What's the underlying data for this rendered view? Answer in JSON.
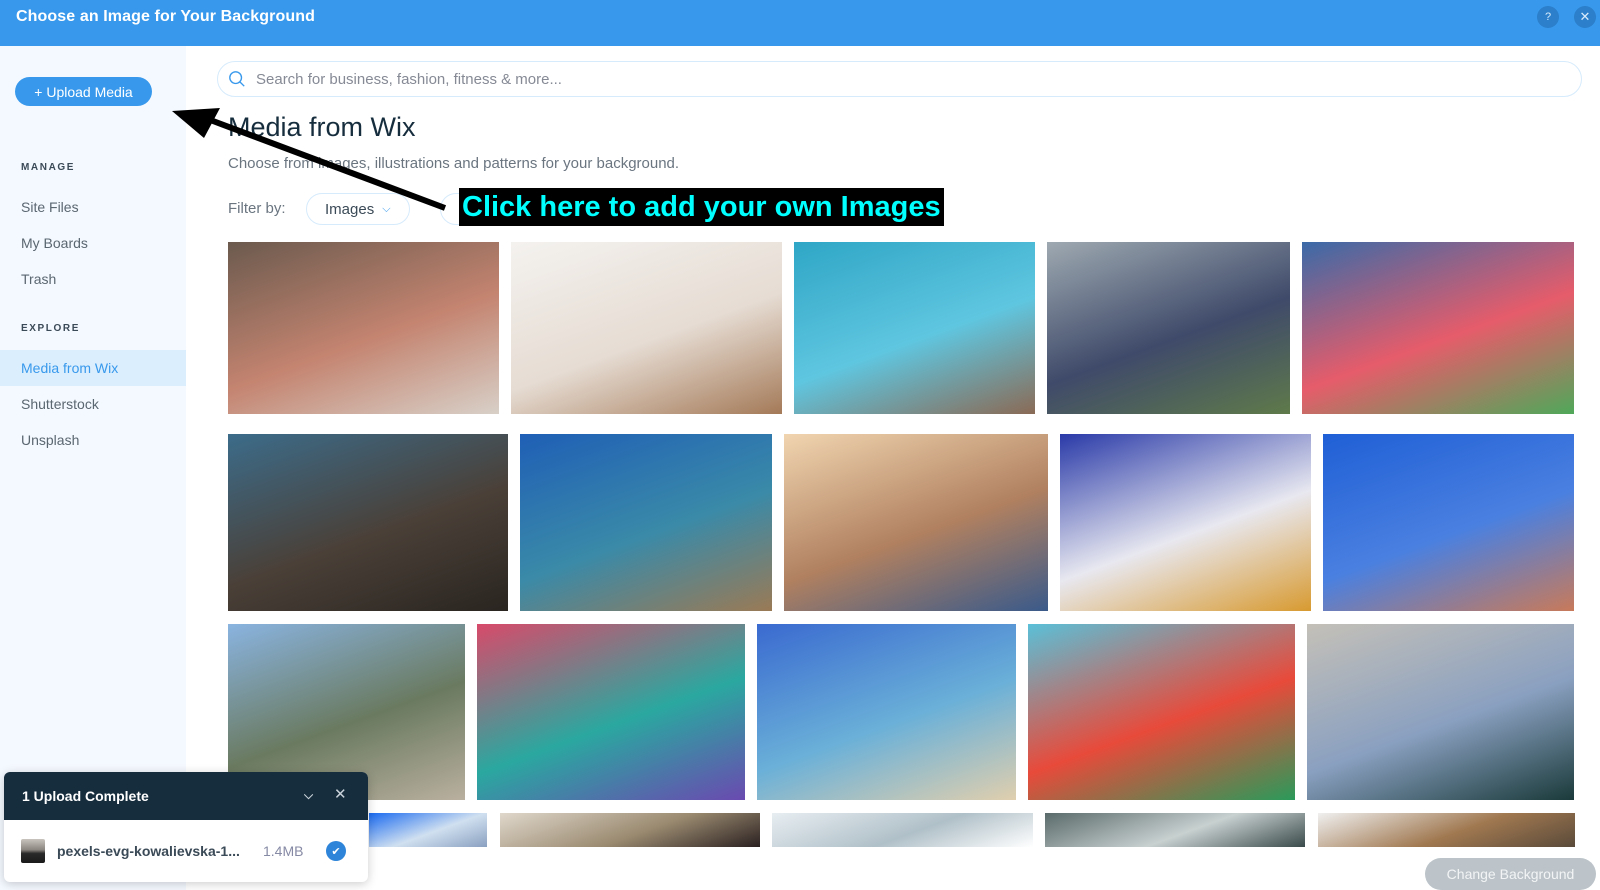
{
  "header": {
    "title": "Choose an Image for Your Background",
    "help_label": "?",
    "close_label": "✕"
  },
  "sidebar": {
    "upload_button": "+ Upload Media",
    "sections": [
      {
        "label": "MANAGE",
        "items": [
          {
            "label": "Site Files"
          },
          {
            "label": "My Boards"
          },
          {
            "label": "Trash"
          }
        ]
      },
      {
        "label": "EXPLORE",
        "items": [
          {
            "label": "Media from Wix",
            "active": true
          },
          {
            "label": "Shutterstock"
          },
          {
            "label": "Unsplash"
          }
        ]
      }
    ]
  },
  "search": {
    "placeholder": "Search for business, fashion, fitness & more...",
    "value": ""
  },
  "main": {
    "title": "Media from Wix",
    "subtitle": "Choose from images, illustrations and patterns for your background.",
    "filter_label": "Filter by:",
    "filters": [
      {
        "label": "Images",
        "chevron": "⌄"
      }
    ]
  },
  "annotation": {
    "text": "Click here to add your own Images",
    "color": "#00ffff"
  },
  "gallery": {
    "rows": [
      [
        {
          "name": "woman-at-desk-image",
          "colors": [
            "#6b5a4e",
            "#c48470",
            "#d8d0c8"
          ]
        },
        {
          "name": "man-with-tablet-image",
          "colors": [
            "#f4f2ef",
            "#e6dcd3",
            "#a47a58"
          ]
        },
        {
          "name": "family-blue-wall-image",
          "colors": [
            "#2fa6c6",
            "#5fc6e0",
            "#8a6a55"
          ]
        },
        {
          "name": "businessmen-city-image",
          "colors": [
            "#9ea9b1",
            "#3f4a6a",
            "#5f7a4a"
          ]
        },
        {
          "name": "confetti-party-image",
          "colors": [
            "#3a6aa8",
            "#e65c6a",
            "#4fa85a"
          ]
        }
      ],
      [
        {
          "name": "pottery-wheel-image",
          "colors": [
            "#3c6c8a",
            "#4a4038",
            "#2a2520"
          ]
        },
        {
          "name": "tree-water-pool-image",
          "colors": [
            "#1f5fb6",
            "#3a8aa8",
            "#9a7a55"
          ]
        },
        {
          "name": "harbor-mountains-image",
          "colors": [
            "#f1d5b0",
            "#b08060",
            "#3a5a8a"
          ]
        },
        {
          "name": "talavera-tiles-image",
          "colors": [
            "#2a3aa8",
            "#e8e8f0",
            "#d89a30"
          ]
        },
        {
          "name": "hillside-town-image",
          "colors": [
            "#1f5fd6",
            "#4a80e0",
            "#c87a5a"
          ]
        }
      ],
      [
        {
          "name": "mountain-valley-image",
          "colors": [
            "#8ab4e0",
            "#6a7a60",
            "#bab0a0"
          ]
        },
        {
          "name": "sugar-skulls-image",
          "colors": [
            "#d84a6a",
            "#2aa8a0",
            "#6a4ab0"
          ]
        },
        {
          "name": "beach-wedding-image",
          "colors": [
            "#3a6ad0",
            "#6ab0d8",
            "#e0cfae"
          ]
        },
        {
          "name": "bird-mural-image",
          "colors": [
            "#5ac0d8",
            "#e84a3a",
            "#2a9a5a"
          ]
        },
        {
          "name": "woman-handbag-image",
          "colors": [
            "#c4c0b8",
            "#8aa0c0",
            "#1a3a3a"
          ]
        }
      ],
      [
        {
          "name": "blue-building-image",
          "colors": [
            "#1a6af0",
            "#d0e0f0",
            "#8aa0c0"
          ]
        },
        {
          "name": "woman-shelves-image",
          "colors": [
            "#e0d8cc",
            "#9a8a70",
            "#2a2020"
          ]
        },
        {
          "name": "lab-glassware-image",
          "colors": [
            "#e8eef2",
            "#b0c0c8",
            "#ffffff"
          ]
        },
        {
          "name": "modern-interior-image",
          "colors": [
            "#5a6a6a",
            "#c8d0d0",
            "#3a4a4a"
          ]
        },
        {
          "name": "autumn-trees-image",
          "colors": [
            "#f0f0f0",
            "#a07850",
            "#5a4a3a"
          ]
        }
      ]
    ]
  },
  "upload_toast": {
    "title": "1 Upload Complete",
    "file_name": "pexels-evg-kowalievska-1...",
    "file_size": "1.4MB",
    "status": "complete"
  },
  "footer": {
    "change_background_label": "Change Background"
  }
}
